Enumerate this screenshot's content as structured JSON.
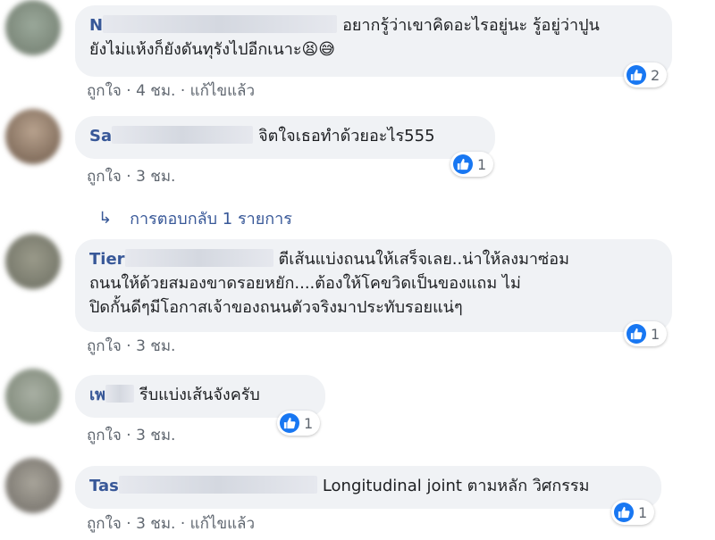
{
  "comments": [
    {
      "name": "N",
      "text_line1": "อยากรู้ว่าเขาคิดอะไรอยู่นะ รู้อยู่ว่าปูน",
      "text_line2": "ยังไม่แห้งก็ยังดันทุรังไปอีกเนาะ",
      "emojis": "😫😅",
      "like": "ถูกใจ",
      "time": "4 ชม.",
      "edited": "แก้ไขแล้ว",
      "reactions": "2"
    },
    {
      "name": "Sa",
      "text": "จิตใจเธอทำด้วยอะไร555",
      "like": "ถูกใจ",
      "time": "3 ชม.",
      "reactions": "1"
    },
    {
      "name": "Tier",
      "text_line1": "ตีเส้นแบ่งถนนให้เสร็จเลย..น่าให้ลงมาซ่อม",
      "text_line2": "ถนนให้ด้วยสมองขาดรอยหยัก....ต้องให้โคขวิดเป็นของแถม ไม่",
      "text_line3": "ปิดกั้นดีๆมีโอกาสเจ้าของถนนตัวจริงมาประทับรอยแน่ๆ",
      "like": "ถูกใจ",
      "time": "3 ชม.",
      "reactions": "1"
    },
    {
      "name": "เพ",
      "text": "รีบแบ่งเส้นจังครับ",
      "like": "ถูกใจ",
      "time": "3 ชม.",
      "reactions": "1"
    },
    {
      "name": "Tas",
      "text": "Longitudinal joint ตามหลัก วิศกรรม",
      "like": "ถูกใจ",
      "time": "3 ชม.",
      "edited": "แก้ไขแล้ว",
      "reactions": "1"
    }
  ],
  "replies_link": "การตอบกลับ 1 รายการ",
  "separator": "·",
  "icons": {
    "like": "thumbs-up-icon",
    "reply": "reply-arrow-icon"
  },
  "colors": {
    "name": "#385898",
    "bubble": "#f0f2f5",
    "like_badge": "#1877f2",
    "meta": "#606770"
  }
}
